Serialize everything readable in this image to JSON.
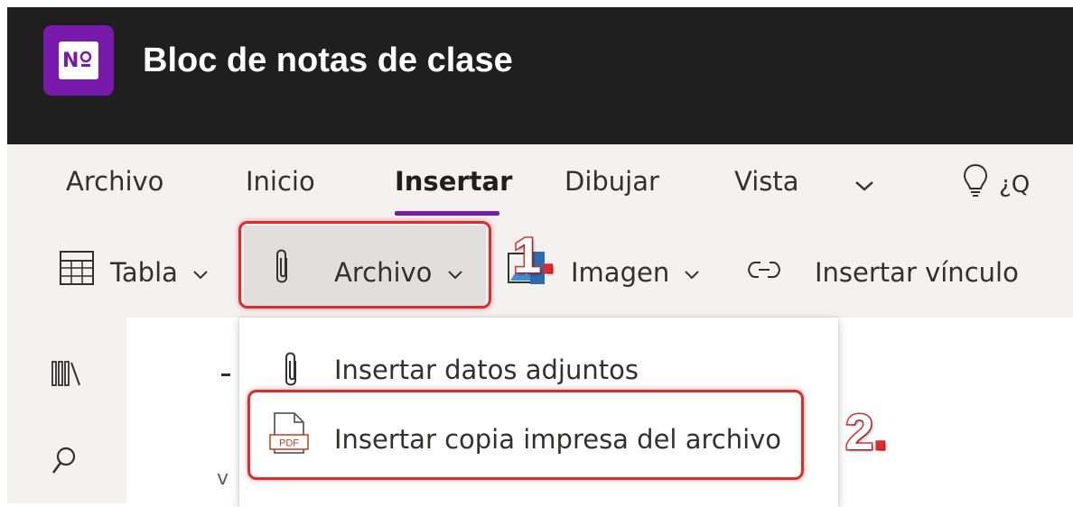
{
  "app": {
    "title": "Bloc de notas de clase",
    "logo_letter": "N",
    "icon": "onenote-logo-icon",
    "brand_color": "#7719aa"
  },
  "ribbon": {
    "tabs": [
      {
        "label": "Archivo",
        "active": false
      },
      {
        "label": "Inicio",
        "active": false
      },
      {
        "label": "Insertar",
        "active": true
      },
      {
        "label": "Dibujar",
        "active": false
      },
      {
        "label": "Vista",
        "active": false
      }
    ],
    "help_text": "¿Q",
    "commands": {
      "tabla_label": "Tabla",
      "archivo_label": "Archivo",
      "imagen_label": "Imagen",
      "insertar_vinculo_label": "Insertar vínculo"
    }
  },
  "dropdown": {
    "items": [
      {
        "label": "Insertar datos adjuntos",
        "icon": "paperclip-icon"
      },
      {
        "label": "Insertar copia impresa del archivo",
        "icon": "pdf-file-icon",
        "icon_text": "PDF"
      }
    ]
  },
  "annotations": {
    "step1": "1",
    "step2": "2",
    "dot": ".",
    "highlight_color": "#e02b2b"
  },
  "page": {
    "partial_text": "v"
  }
}
